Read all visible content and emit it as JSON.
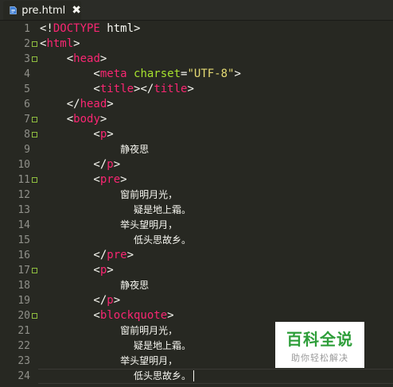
{
  "tab": {
    "title": "pre.html",
    "close_label": "✖"
  },
  "colors": {
    "tag": "#f92672",
    "attr": "#a6e22e",
    "string": "#e6db74",
    "text": "#f8f8f2",
    "gutter_text": "#90908a",
    "background": "#272822"
  },
  "lines": [
    {
      "n": "1",
      "fold": false,
      "tokens": [
        [
          "punc",
          "<!"
        ],
        [
          "tag",
          "DOCTYPE"
        ],
        [
          "punc",
          " html>"
        ]
      ]
    },
    {
      "n": "2",
      "fold": true,
      "tokens": [
        [
          "punc",
          "<"
        ],
        [
          "tag",
          "html"
        ],
        [
          "punc",
          ">"
        ]
      ]
    },
    {
      "n": "3",
      "fold": true,
      "tokens": [
        [
          "punc",
          "    <"
        ],
        [
          "tag",
          "head"
        ],
        [
          "punc",
          ">"
        ]
      ]
    },
    {
      "n": "4",
      "fold": false,
      "tokens": [
        [
          "punc",
          "        <"
        ],
        [
          "tag",
          "meta"
        ],
        [
          "punc",
          " "
        ],
        [
          "attr",
          "charset"
        ],
        [
          "punc",
          "="
        ],
        [
          "str",
          "\"UTF-8\""
        ],
        [
          "punc",
          ">"
        ]
      ]
    },
    {
      "n": "5",
      "fold": false,
      "tokens": [
        [
          "punc",
          "        <"
        ],
        [
          "tag",
          "title"
        ],
        [
          "punc",
          "></"
        ],
        [
          "tag",
          "title"
        ],
        [
          "punc",
          ">"
        ]
      ]
    },
    {
      "n": "6",
      "fold": false,
      "tokens": [
        [
          "punc",
          "    </"
        ],
        [
          "tag",
          "head"
        ],
        [
          "punc",
          ">"
        ]
      ]
    },
    {
      "n": "7",
      "fold": true,
      "tokens": [
        [
          "punc",
          "    <"
        ],
        [
          "tag",
          "body"
        ],
        [
          "punc",
          ">"
        ]
      ]
    },
    {
      "n": "8",
      "fold": true,
      "tokens": [
        [
          "punc",
          "        <"
        ],
        [
          "tag",
          "p"
        ],
        [
          "punc",
          ">"
        ]
      ]
    },
    {
      "n": "9",
      "fold": false,
      "tokens": [
        [
          "punc",
          "            "
        ],
        [
          "txt",
          "静夜思"
        ]
      ]
    },
    {
      "n": "10",
      "fold": false,
      "tokens": [
        [
          "punc",
          "        </"
        ],
        [
          "tag",
          "p"
        ],
        [
          "punc",
          ">"
        ]
      ]
    },
    {
      "n": "11",
      "fold": true,
      "tokens": [
        [
          "punc",
          "        <"
        ],
        [
          "tag",
          "pre"
        ],
        [
          "punc",
          ">"
        ]
      ]
    },
    {
      "n": "12",
      "fold": false,
      "tokens": [
        [
          "punc",
          "            "
        ],
        [
          "txt",
          "窗前明月光，"
        ]
      ]
    },
    {
      "n": "13",
      "fold": false,
      "tokens": [
        [
          "punc",
          "              "
        ],
        [
          "txt",
          "疑是地上霜。"
        ]
      ]
    },
    {
      "n": "14",
      "fold": false,
      "tokens": [
        [
          "punc",
          "            "
        ],
        [
          "txt",
          "举头望明月，"
        ]
      ]
    },
    {
      "n": "15",
      "fold": false,
      "tokens": [
        [
          "punc",
          "              "
        ],
        [
          "txt",
          "低头思故乡。"
        ]
      ]
    },
    {
      "n": "16",
      "fold": false,
      "tokens": [
        [
          "punc",
          "        </"
        ],
        [
          "tag",
          "pre"
        ],
        [
          "punc",
          ">"
        ]
      ]
    },
    {
      "n": "17",
      "fold": true,
      "tokens": [
        [
          "punc",
          "        <"
        ],
        [
          "tag",
          "p"
        ],
        [
          "punc",
          ">"
        ]
      ]
    },
    {
      "n": "18",
      "fold": false,
      "tokens": [
        [
          "punc",
          "            "
        ],
        [
          "txt",
          "静夜思"
        ]
      ]
    },
    {
      "n": "19",
      "fold": false,
      "tokens": [
        [
          "punc",
          "        </"
        ],
        [
          "tag",
          "p"
        ],
        [
          "punc",
          ">"
        ]
      ]
    },
    {
      "n": "20",
      "fold": true,
      "tokens": [
        [
          "punc",
          "        <"
        ],
        [
          "tag",
          "blockquote"
        ],
        [
          "punc",
          ">"
        ]
      ]
    },
    {
      "n": "21",
      "fold": false,
      "tokens": [
        [
          "punc",
          "            "
        ],
        [
          "txt",
          "窗前明月光，"
        ]
      ]
    },
    {
      "n": "22",
      "fold": false,
      "tokens": [
        [
          "punc",
          "              "
        ],
        [
          "txt",
          "疑是地上霜。"
        ]
      ]
    },
    {
      "n": "23",
      "fold": false,
      "tokens": [
        [
          "punc",
          "            "
        ],
        [
          "txt",
          "举头望明月，"
        ]
      ]
    },
    {
      "n": "24",
      "fold": false,
      "tokens": [
        [
          "punc",
          "              "
        ],
        [
          "txt",
          "低头思故乡。"
        ]
      ]
    }
  ],
  "current_line": "24",
  "watermark": {
    "title": "百科全说",
    "subtitle": "助你轻松解决"
  }
}
